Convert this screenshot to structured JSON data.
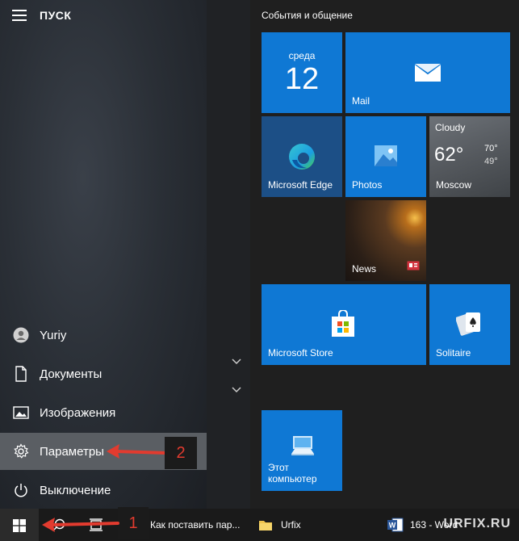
{
  "start_menu": {
    "title": "ПУСК",
    "left_items": [
      {
        "label": "Yuriy",
        "icon": "user-icon"
      },
      {
        "label": "Документы",
        "icon": "document-icon"
      },
      {
        "label": "Изображения",
        "icon": "image-icon"
      },
      {
        "label": "Параметры",
        "icon": "gear-icon",
        "highlighted": true
      },
      {
        "label": "Выключение",
        "icon": "power-icon"
      }
    ]
  },
  "tiles": {
    "group_title": "События и общение",
    "calendar": {
      "day_name": "среда",
      "day_number": "12"
    },
    "mail": {
      "label": "Mail"
    },
    "edge": {
      "label": "Microsoft Edge"
    },
    "photos": {
      "label": "Photos"
    },
    "weather": {
      "condition": "Cloudy",
      "temp": "62°",
      "high": "70°",
      "low": "49°",
      "city": "Moscow"
    },
    "news": {
      "label": "News"
    },
    "store": {
      "label": "Microsoft Store"
    },
    "solitaire": {
      "label": "Solitaire"
    },
    "computer": {
      "label_line1": "Этот",
      "label_line2": "компьютер"
    }
  },
  "annotations": {
    "badge1": "1",
    "badge2": "2",
    "accent_color": "#e23b2f"
  },
  "taskbar": {
    "items": [
      {
        "label": "Как поставить пар...",
        "icon": "chrome-icon"
      },
      {
        "label": "Urfix",
        "icon": "folder-icon"
      },
      {
        "label": "163 - Word",
        "icon": "word-icon"
      }
    ]
  },
  "watermark": "URFIX.RU"
}
